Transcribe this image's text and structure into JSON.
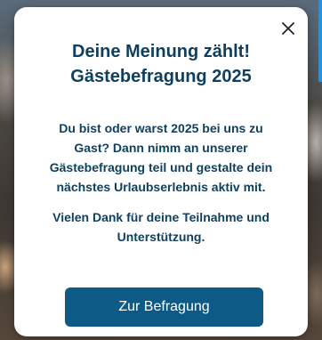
{
  "modal": {
    "title_lines": [
      "Deine Meinung zählt!",
      "Gästebefragung 2025"
    ],
    "body_lines": [
      "Du bist oder warst 2025 bei uns zu",
      "Gast? Dann nimm an unserer",
      "Gästebefragung teil und gestalte dein",
      "nächstes Urlaubserlebnis aktiv mit."
    ],
    "thanks_lines": [
      "Vielen Dank für deine Teilnahme und",
      "Unterstützung."
    ],
    "cta_label": "Zur Befragung",
    "close_icon": "close-icon"
  },
  "colors": {
    "text": "#0f3f5c",
    "button_bg": "#0d5a87",
    "button_text": "#ffffff",
    "modal_bg": "#ffffff"
  }
}
